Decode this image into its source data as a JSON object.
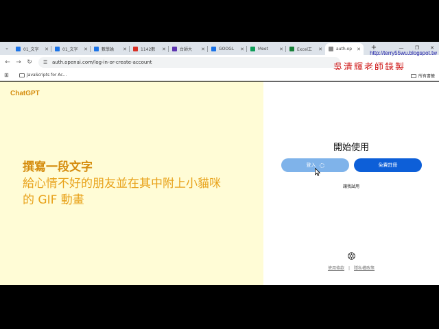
{
  "browser": {
    "tabs": [
      {
        "label": "01_文字",
        "color": "#1a73e8",
        "active": false
      },
      {
        "label": "01_文字",
        "color": "#1a73e8",
        "active": false
      },
      {
        "label": "數學論",
        "color": "#1a73e8",
        "active": false
      },
      {
        "label": "1142數",
        "color": "#d93025",
        "active": false
      },
      {
        "label": "台師大",
        "color": "#5e35b1",
        "active": false
      },
      {
        "label": "GOOGL",
        "color": "#1a73e8",
        "active": false
      },
      {
        "label": "Meet",
        "color": "#0f9d58",
        "active": false
      },
      {
        "label": "Excel工",
        "color": "#188038",
        "active": false
      },
      {
        "label": "auth.op",
        "color": "#888888",
        "active": true
      }
    ],
    "new_tab": "+",
    "url": "auth.openai.com/log-in-or-create-account",
    "bookmark": "JavaScripts for Ac...",
    "all_bookmarks": "所有書籤"
  },
  "watermark": {
    "url": "http://terry55wu.blogspot.tw",
    "name": "吳清輝老師錄製"
  },
  "page": {
    "brand": "ChatGPT",
    "hero": {
      "line1": "撰寫一段文字",
      "line2": "給心情不好的朋友並在其中附上小貓咪",
      "line3": "的 GIF 動畫"
    },
    "heading": "開始使用",
    "login_label": "登入",
    "signup_label": "免費註冊",
    "try_label": "讓我試用",
    "footer": {
      "terms": "使用條款",
      "separator": "|",
      "privacy": "隱私權政策"
    }
  },
  "colors": {
    "accent": "#d58c0d",
    "left_bg": "#fffcd6",
    "primary_button": "#0d5fd8",
    "login_button_loading": "#7fb3ea"
  }
}
